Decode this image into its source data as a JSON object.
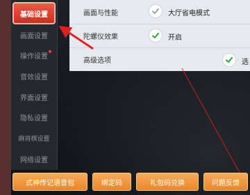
{
  "sidebar": {
    "items": [
      {
        "label": "基础设置"
      },
      {
        "label": "画面设置"
      },
      {
        "label": "操作设置"
      },
      {
        "label": "音效设置"
      },
      {
        "label": "界面设置"
      },
      {
        "label": "隐私设置"
      },
      {
        "label": "麻将棋设置"
      },
      {
        "label": "网络设置"
      }
    ],
    "active_index": 0,
    "badge_item_index": 2
  },
  "settings": {
    "rows": [
      {
        "label": "画面与性能",
        "option_text": "大厅省电模式",
        "checked": false
      },
      {
        "label": "陀螺仪效果",
        "option_text": "开启",
        "checked": true
      },
      {
        "label": "高级选项",
        "option_text": "选",
        "checked": true
      }
    ]
  },
  "buttons": [
    {
      "label": "式神传记语音包"
    },
    {
      "label": "绑定码"
    },
    {
      "label": "礼包码兑换"
    },
    {
      "label": "问题反馈"
    }
  ],
  "colors": {
    "accent_red": "#e0201f",
    "check_green": "#3cb043",
    "button_orange": "#ef9a3f"
  }
}
